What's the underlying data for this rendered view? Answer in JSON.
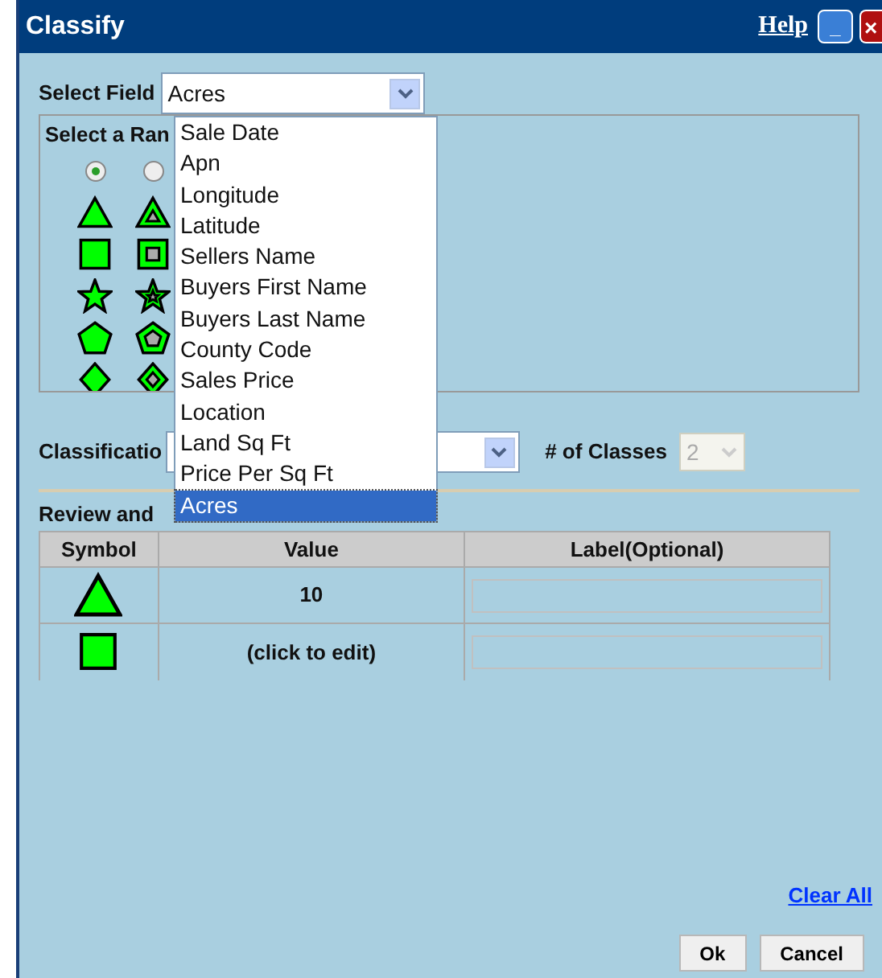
{
  "window": {
    "title": "Classify",
    "help_link": "Help",
    "minimize_button": "_",
    "close_button": "×"
  },
  "select_field": {
    "label": "Select Field",
    "value": "Acres",
    "expanded": true,
    "options": [
      {
        "label": "Sale Date",
        "selected": false
      },
      {
        "label": "Apn",
        "selected": false
      },
      {
        "label": "Longitude",
        "selected": false
      },
      {
        "label": "Latitude",
        "selected": false
      },
      {
        "label": "Sellers Name",
        "selected": false
      },
      {
        "label": "Buyers First Name",
        "selected": false
      },
      {
        "label": "Buyers Last Name",
        "selected": false
      },
      {
        "label": "County Code",
        "selected": false
      },
      {
        "label": "Sales Price",
        "selected": false
      },
      {
        "label": "Location",
        "selected": false
      },
      {
        "label": "Land Sq Ft",
        "selected": false
      },
      {
        "label": "Price Per Sq Ft",
        "selected": false
      },
      {
        "label": "Acres",
        "selected": true
      }
    ]
  },
  "symbol_range": {
    "title": "Select a Ran",
    "sets": [
      {
        "kind": "solid",
        "selected": true
      },
      {
        "kind": "outlined",
        "selected": false
      }
    ]
  },
  "classification": {
    "label": "Classificatio"
  },
  "classes": {
    "label": "# of Classes",
    "value": "2",
    "disabled": true
  },
  "review": {
    "title": "Review and",
    "columns": [
      "Symbol",
      "Value",
      "Label(Optional)"
    ],
    "rows": [
      {
        "kind": "triangle",
        "value": "10"
      },
      {
        "kind": "square",
        "value": "(click to edit)"
      }
    ]
  },
  "clear_all": "Clear All",
  "buttons": [
    "Ok",
    "Cancel"
  ]
}
